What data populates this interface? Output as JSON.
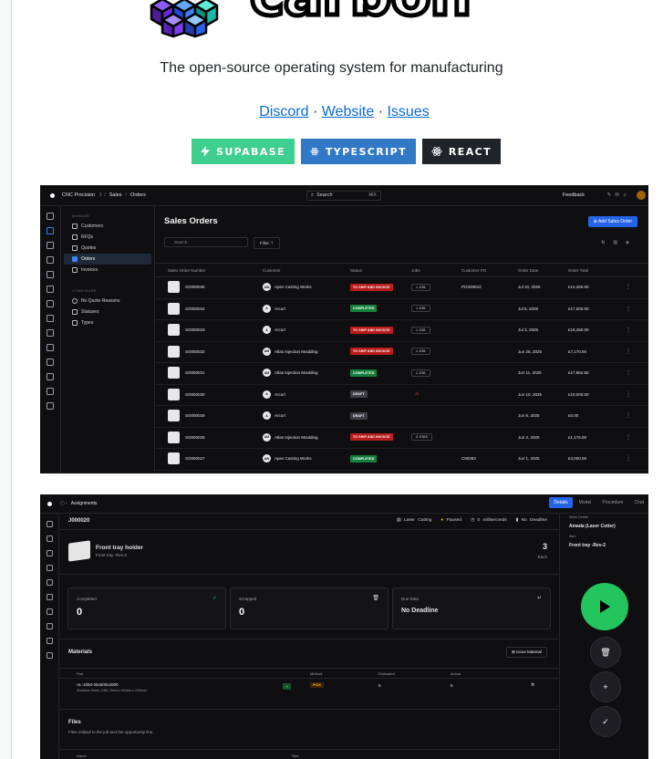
{
  "hero": {
    "wordmark": "carbon",
    "tagline": "The open-source operating system for manufacturing",
    "links": [
      {
        "label": "Discord"
      },
      {
        "label": "Website"
      },
      {
        "label": "Issues"
      }
    ],
    "separator": "·",
    "badges": [
      {
        "label": "SUPABASE",
        "color": "#3ECF8E",
        "icon": "bolt-icon"
      },
      {
        "label": "TYPESCRIPT",
        "color": "#3178C6",
        "icon": "react-atom-icon"
      },
      {
        "label": "REACT",
        "color": "#20232A",
        "icon": "react-atom-icon"
      }
    ]
  },
  "sales_orders": {
    "topbar": {
      "company": "CNC Precision",
      "breadcrumbs": [
        "Sales",
        "Orders"
      ],
      "search": "Search",
      "shortcut": "⌘K",
      "feedback": "Feedback"
    },
    "sidebar": {
      "manage_heading": "MANAGE",
      "manage_items": [
        "Customers",
        "RFQs",
        "Quotes",
        "Orders",
        "Invoices"
      ],
      "configure_heading": "CONFIGURE",
      "configure_items": [
        "No Quote Reasons",
        "Statuses",
        "Types"
      ]
    },
    "title": "Sales Orders",
    "add_button": "Add Sales Order",
    "search_placeholder": "Search",
    "filter_label": "Filter",
    "columns": [
      "Sales Order Number",
      "Customer",
      "Status",
      "Jobs",
      "Customer PO",
      "Order Date",
      "Order Total"
    ],
    "rows": [
      {
        "num": "SO000035",
        "customer": "Apex Casting Works",
        "initials": "AW",
        "status": "TO SHIP AND INVOICE",
        "kind": "ship",
        "jobs": "1 JOB",
        "po": "PO329023",
        "date": "Jul 10, 2025",
        "total": "£12,450.00"
      },
      {
        "num": "SO000034",
        "customer": "Arcurt",
        "initials": "A",
        "status": "COMPLETED",
        "kind": "comp",
        "jobs": "1 JOB",
        "po": "",
        "date": "Jul 8, 2025",
        "total": "£17,500.00"
      },
      {
        "num": "SO000033",
        "customer": "Arcurt",
        "initials": "A",
        "status": "TO SHIP AND INVOICE",
        "kind": "ship",
        "jobs": "1 JOB",
        "po": "",
        "date": "Jul 3, 2025",
        "total": "£18,450.00"
      },
      {
        "num": "SO000032",
        "customer": "Atlas Injection Moulding",
        "initials": "AM",
        "status": "TO SHIP AND INVOICE",
        "kind": "ship",
        "jobs": "1 JOB",
        "po": "",
        "date": "Jun 26, 2025",
        "total": "£7,170.00"
      },
      {
        "num": "SO000031",
        "customer": "Atlas Injection Moulding",
        "initials": "AM",
        "status": "COMPLETED",
        "kind": "comp",
        "jobs": "1 JOB",
        "po": "",
        "date": "Jun 11, 2025",
        "total": "£17,962.50"
      },
      {
        "num": "SO000030",
        "customer": "Arcurt",
        "initials": "A",
        "status": "DRAFT",
        "kind": "draft",
        "jobs": "",
        "po": "",
        "date": "Jun 10, 2025",
        "total": "£10,000.00"
      },
      {
        "num": "SO000029",
        "customer": "Arcurt",
        "initials": "A",
        "status": "DRAFT",
        "kind": "draft",
        "jobs": "",
        "po": "",
        "date": "Jun 6, 2025",
        "total": "£0.00"
      },
      {
        "num": "SO000028",
        "customer": "Atlas Injection Moulding",
        "initials": "AM",
        "status": "TO SHIP AND INVOICE",
        "kind": "ship",
        "jobs": "3 JOBS",
        "po": "",
        "date": "Jun 2, 2025",
        "total": "£1,176.00"
      },
      {
        "num": "SO000027",
        "customer": "Apex Casting Works",
        "initials": "AW",
        "status": "COMPLETED",
        "kind": "comp",
        "jobs": "",
        "po": "C90393",
        "date": "Jun 1, 2025",
        "total": "£3,000.00"
      }
    ]
  },
  "assignment": {
    "topbar": {
      "crumb": "Assignments",
      "tabs": [
        "Details",
        "Model",
        "Procedure",
        "Chat"
      ]
    },
    "job_id": "J000020",
    "meta": [
      "Laser Cutting",
      "Paused",
      "0 milliseconds",
      "No Deadline"
    ],
    "item_title": "Front tray holder",
    "item_sub": "Front tray -Rev-2",
    "qty": "3",
    "qty_unit": "Each",
    "completed_label": "Completed",
    "completed_value": "0",
    "scrapped_label": "Scrapped",
    "scrapped_value": "0",
    "due_label": "Due Date",
    "due_value": "No Deadline",
    "materials_title": "Materials",
    "issue_label": "Issue Material",
    "mat_cols": [
      "Part",
      "Method",
      "Estimated",
      "Actual"
    ],
    "mat_part": "AL-1050-25x500x2000",
    "mat_desc": "Aluminum Sheet, 1050, 25mm x 500mm x 2000mm",
    "mat_method": "PICK",
    "mat_est": "6",
    "mat_act": "6",
    "files_title": "Files",
    "files_sub": "Files related to the job and the opportunity line.",
    "file_cols": [
      "Name",
      "Size"
    ],
    "wo_label": "Work Center",
    "wo_value": "Amada (Laser Cutter)",
    "item_label": "Item",
    "item_value": "Front tray -Rev-2"
  }
}
